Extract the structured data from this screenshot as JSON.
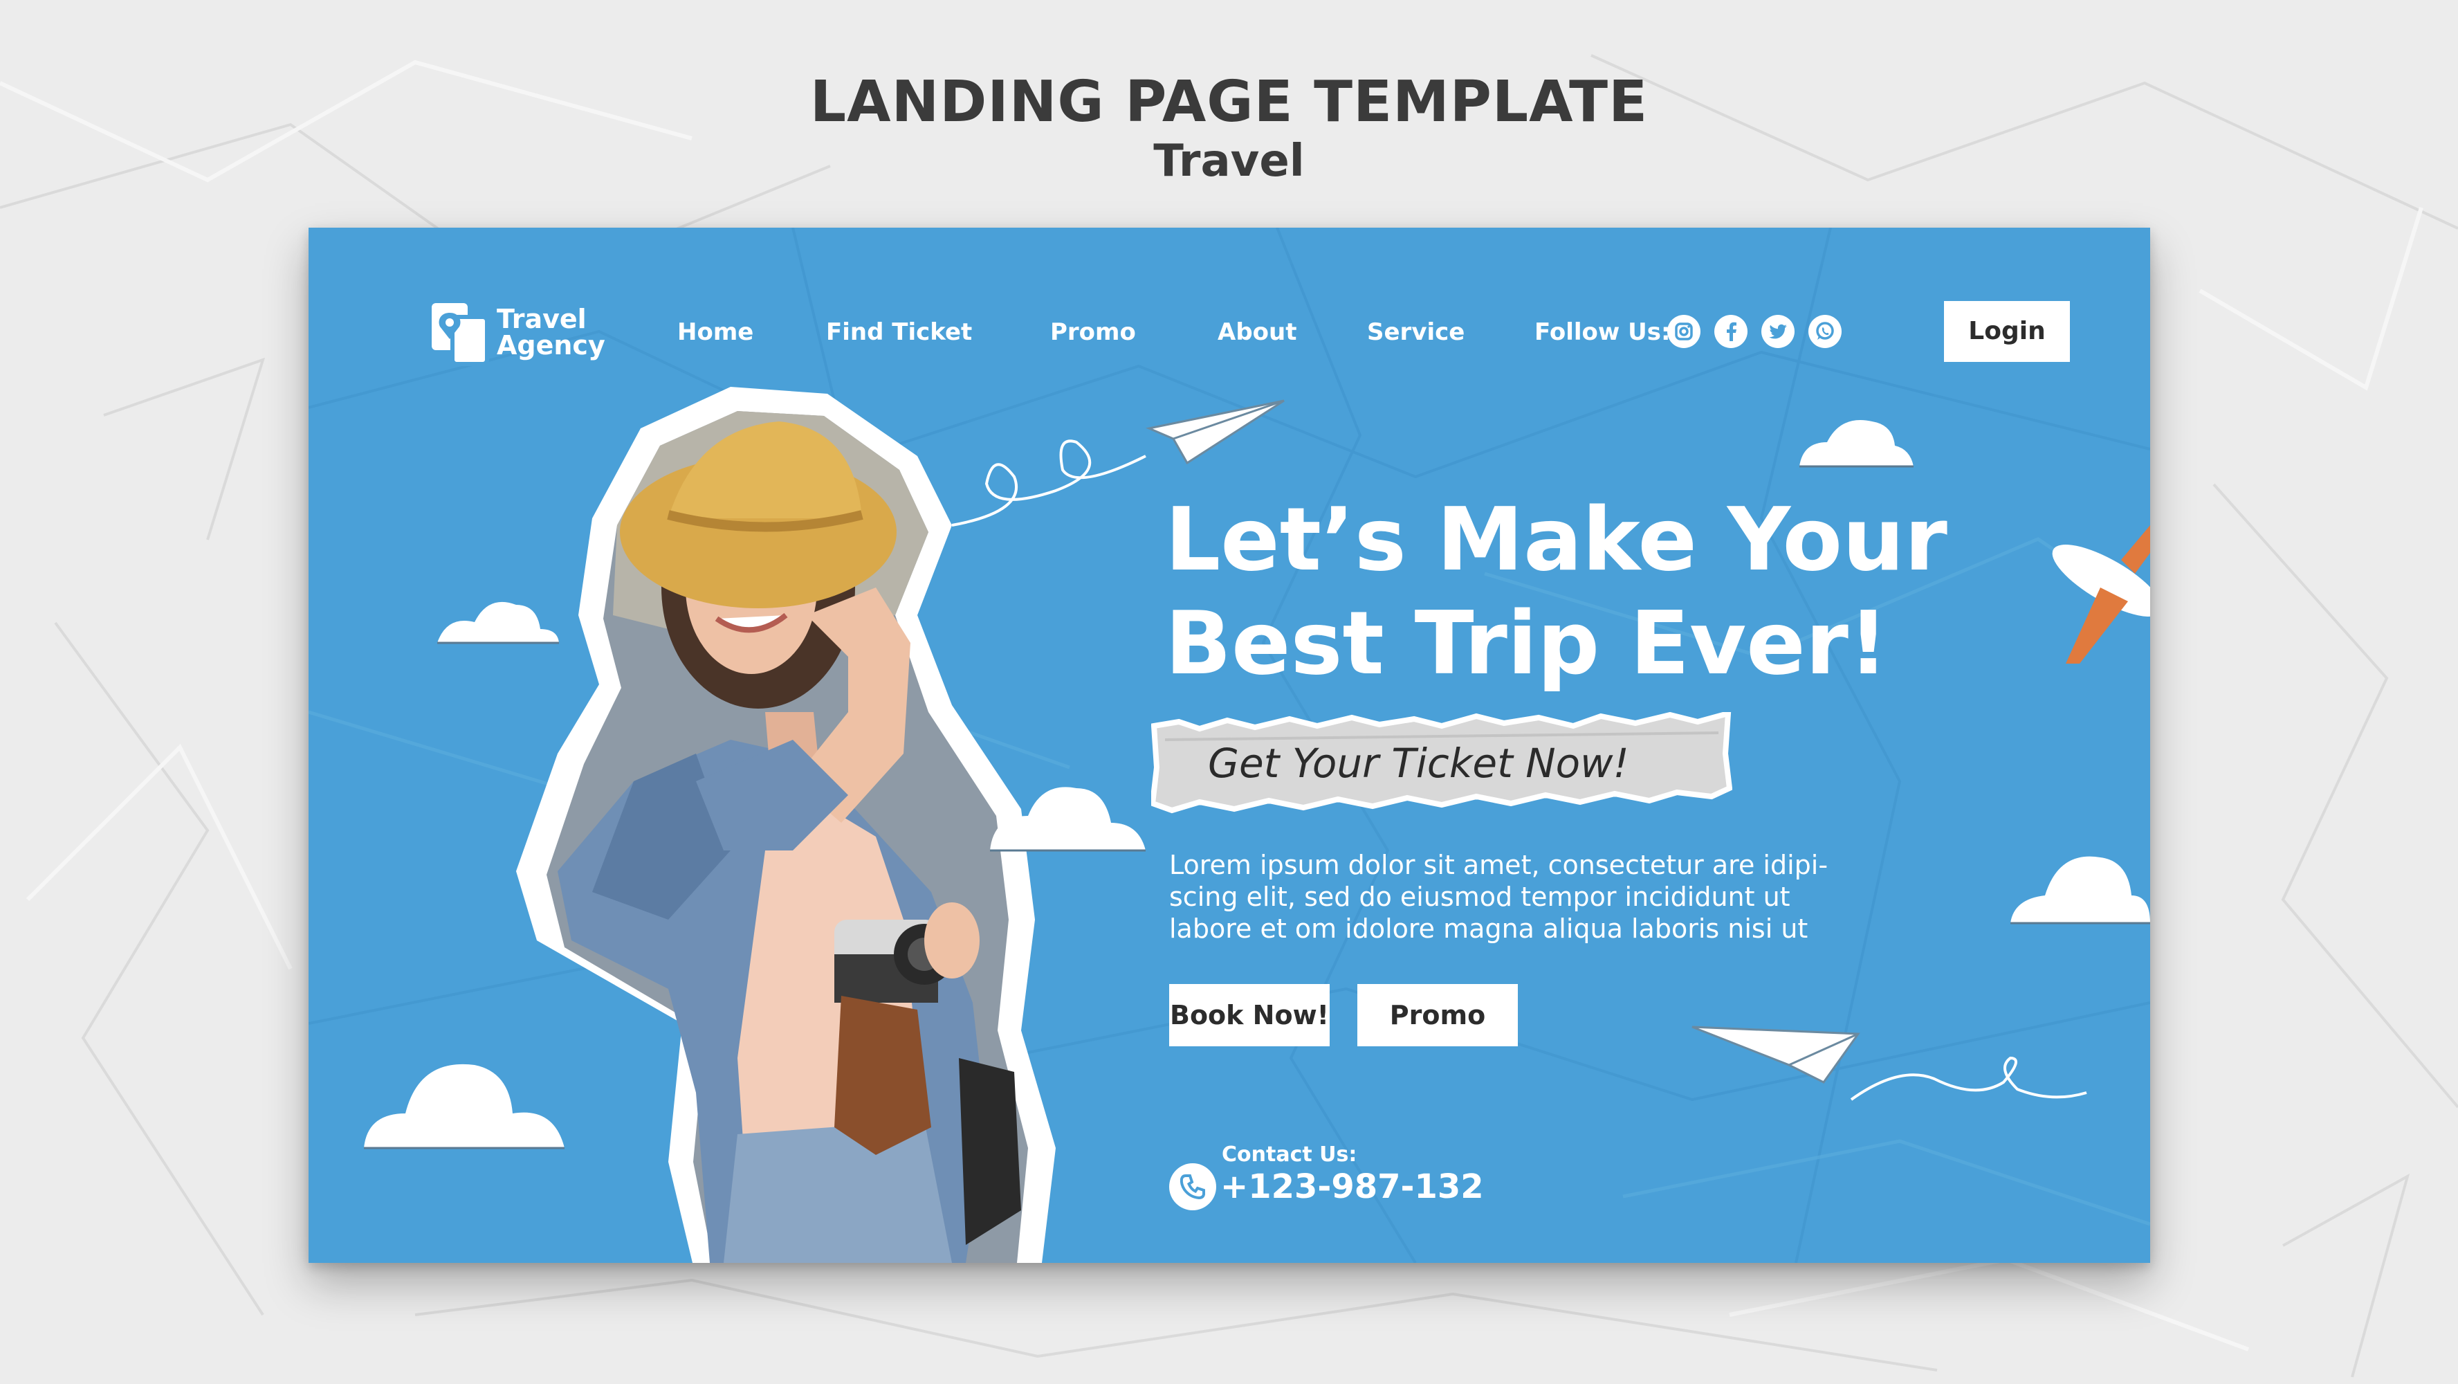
{
  "page": {
    "heading": "LANDING PAGE TEMPLATE",
    "subheading": "Travel"
  },
  "brand": {
    "name_line1": "Travel",
    "name_line2": "Agency",
    "logo_icon": "location-pin-icon"
  },
  "nav": {
    "items": [
      {
        "label": "Home"
      },
      {
        "label": "Find Ticket"
      },
      {
        "label": "Promo"
      },
      {
        "label": "About"
      },
      {
        "label": "Service"
      }
    ],
    "follow_label": "Follow Us:",
    "social_icons": [
      "instagram-icon",
      "facebook-icon",
      "twitter-icon",
      "whatsapp-icon"
    ],
    "login_label": "Login"
  },
  "hero": {
    "title_line1": "Let’s Make Your",
    "title_line2": "Best Trip Ever!",
    "ticket_tagline": "Get Your Ticket Now!",
    "body_lines": [
      "Lorem ipsum dolor sit amet, consectetur are  idipi-",
      "scing elit, sed do eiusmod tempor incididunt ut",
      "labore et  om idolore magna aliqua laboris nisi ut"
    ],
    "book_button": "Book Now!",
    "promo_button": "Promo"
  },
  "contact": {
    "label": "Contact Us:",
    "phone": "+123-987-132",
    "icon": "phone-icon"
  },
  "colors": {
    "panel_blue": "#4aa0d8",
    "text_dark": "#3b3b3b",
    "white": "#ffffff",
    "plane_orange": "#e07a3e"
  }
}
